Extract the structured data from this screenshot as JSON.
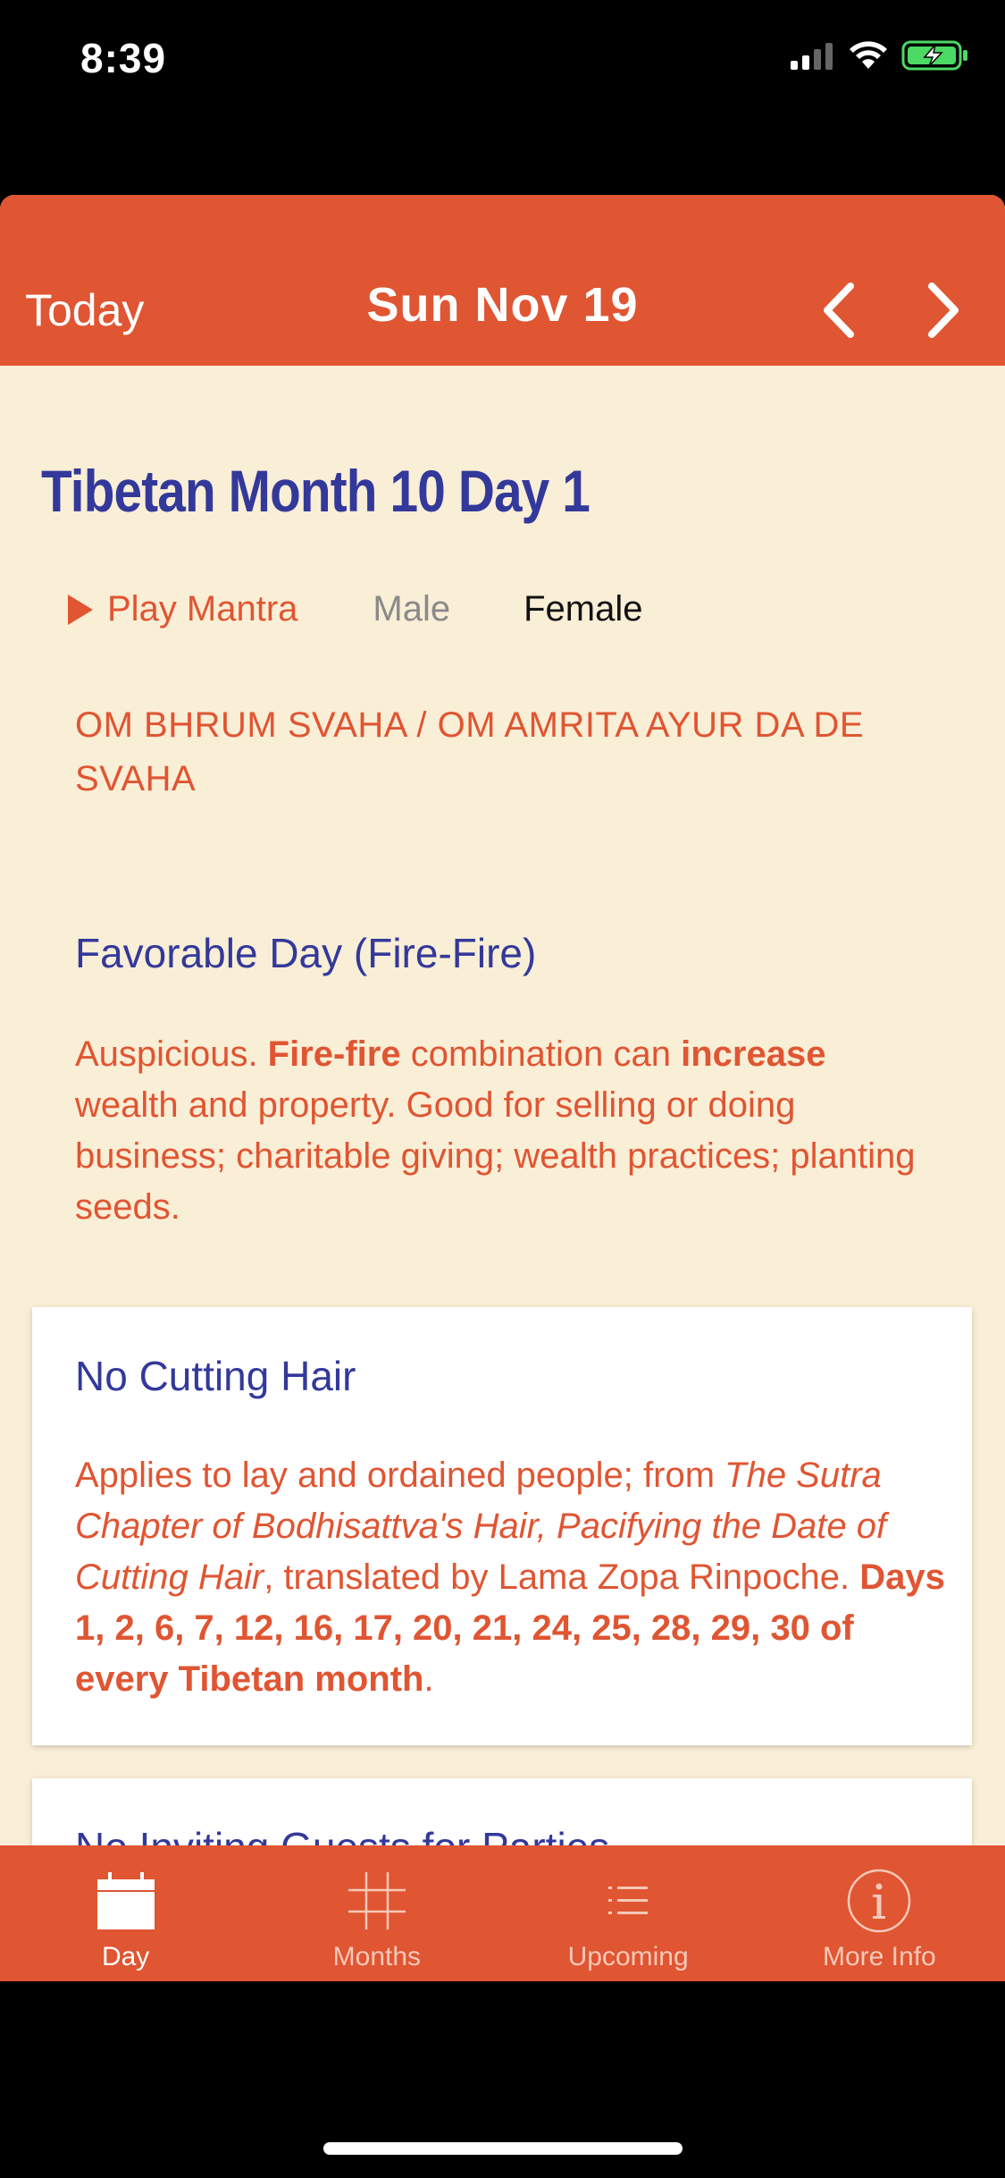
{
  "status": {
    "time": "8:39"
  },
  "nav": {
    "today_label": "Today",
    "title": "Sun Nov 19"
  },
  "content": {
    "heading": "Tibetan Month 10 Day 1",
    "mantra": {
      "play_label": "Play Mantra",
      "male_label": "Male",
      "female_label": "Female",
      "selected": "Female",
      "text": "OM BHRUM SVAHA / OM AMRITA AYUR DA DE SVAHA"
    },
    "favorable": {
      "title": "Favorable Day (Fire-Fire)",
      "body_1": "Auspicious. ",
      "body_bold_1": "Fire-fire",
      "body_2": " combination can ",
      "body_bold_2": "increase",
      "body_3": " wealth and property. Good for selling or doing business; charitable giving; wealth practices; planting seeds."
    },
    "cards": [
      {
        "title": "No Cutting Hair",
        "body_1": "Applies to lay and ordained people; from ",
        "body_italic": "The Sutra Chapter of Bodhisattva's Hair, Pacifying the Date of Cutting Hair",
        "body_2": ", translated by Lama Zopa Rinpoche. ",
        "body_bold": "Days 1, 2, 6, 7, 12, 16, 17, 20, 21, 24, 25, 28, 29, 30 of every Tibetan month",
        "body_3": "."
      },
      {
        "title": "No Inviting Guests for Parties"
      }
    ]
  },
  "tabbar": {
    "tabs": [
      {
        "label": "Day",
        "icon": "calendar-icon",
        "active": true
      },
      {
        "label": "Months",
        "icon": "grid-icon",
        "active": false
      },
      {
        "label": "Upcoming",
        "icon": "list-icon",
        "active": false
      },
      {
        "label": "More Info",
        "icon": "info-icon",
        "active": false
      }
    ]
  },
  "colors": {
    "accent": "#e05532",
    "heading": "#33399a",
    "background": "#f9eed6"
  }
}
